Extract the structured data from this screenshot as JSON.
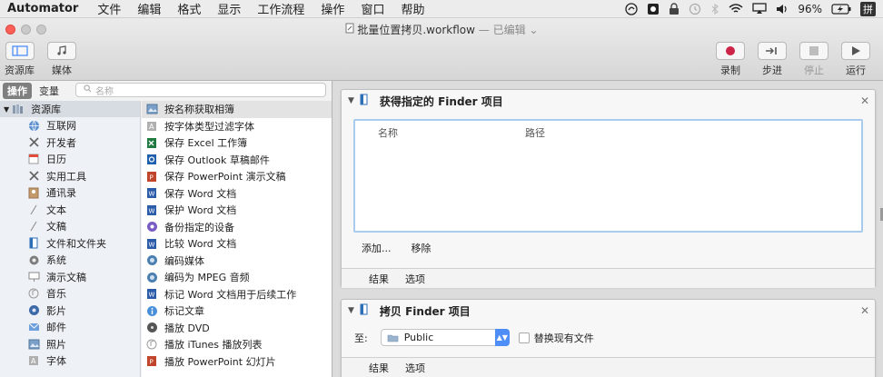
{
  "menubar": {
    "app": "Automator",
    "items": [
      "文件",
      "编辑",
      "格式",
      "显示",
      "工作流程",
      "操作",
      "窗口",
      "帮助"
    ],
    "battery": "96%",
    "input_method": "拼"
  },
  "window": {
    "title": "批量位置拷贝.workflow",
    "edited": "— 已编辑"
  },
  "toolbar": {
    "library": "资源库",
    "media": "媒体",
    "record": "录制",
    "step": "步进",
    "stop": "停止",
    "run": "运行"
  },
  "tabs": {
    "actions": "操作",
    "variables": "变量",
    "search_placeholder": "名称"
  },
  "library": {
    "header": "资源库",
    "items": [
      {
        "label": "互联网",
        "icon": "globe-icon"
      },
      {
        "label": "开发者",
        "icon": "tools-icon"
      },
      {
        "label": "日历",
        "icon": "calendar-icon"
      },
      {
        "label": "实用工具",
        "icon": "tools-icon"
      },
      {
        "label": "通讯录",
        "icon": "contacts-icon"
      },
      {
        "label": "文本",
        "icon": "pen-icon"
      },
      {
        "label": "文稿",
        "icon": "pen-icon"
      },
      {
        "label": "文件和文件夹",
        "icon": "finder-icon"
      },
      {
        "label": "系统",
        "icon": "gear-icon"
      },
      {
        "label": "演示文稿",
        "icon": "presentation-icon"
      },
      {
        "label": "音乐",
        "icon": "music-icon"
      },
      {
        "label": "影片",
        "icon": "film-icon"
      },
      {
        "label": "邮件",
        "icon": "mail-icon"
      },
      {
        "label": "照片",
        "icon": "photo-icon"
      },
      {
        "label": "字体",
        "icon": "font-icon"
      }
    ]
  },
  "actions": {
    "items": [
      {
        "label": "按名称获取相簿",
        "icon": "photo-icon",
        "color": "#6a8fb5"
      },
      {
        "label": "按字体类型过滤字体",
        "icon": "font-icon",
        "color": "#8a8a8a"
      },
      {
        "label": "保存 Excel 工作簿",
        "icon": "excel-icon",
        "color": "#1f7a3f"
      },
      {
        "label": "保存 Outlook 草稿邮件",
        "icon": "outlook-icon",
        "color": "#1f5fb0"
      },
      {
        "label": "保存 PowerPoint 演示文稿",
        "icon": "powerpoint-icon",
        "color": "#c0452a"
      },
      {
        "label": "保存 Word 文档",
        "icon": "word-icon",
        "color": "#2b5caa"
      },
      {
        "label": "保护 Word 文档",
        "icon": "word-icon",
        "color": "#2b5caa"
      },
      {
        "label": "备份指定的设备",
        "icon": "backup-icon",
        "color": "#7a5bc4"
      },
      {
        "label": "比较 Word 文档",
        "icon": "word-icon",
        "color": "#2b5caa"
      },
      {
        "label": "编码媒体",
        "icon": "media-icon",
        "color": "#4a7fb0"
      },
      {
        "label": "编码为 MPEG 音频",
        "icon": "media-icon",
        "color": "#4a7fb0"
      },
      {
        "label": "标记 Word 文档用于后续工作",
        "icon": "word-icon",
        "color": "#2b5caa"
      },
      {
        "label": "标记文章",
        "icon": "info-icon",
        "color": "#4a90d9"
      },
      {
        "label": "播放 DVD",
        "icon": "dvd-icon",
        "color": "#666666"
      },
      {
        "label": "播放 iTunes 播放列表",
        "icon": "music-icon",
        "color": "#888888"
      },
      {
        "label": "播放 PowerPoint 幻灯片",
        "icon": "powerpoint-icon",
        "color": "#c0452a"
      }
    ]
  },
  "workflow": {
    "card1": {
      "title": "获得指定的 Finder 项目",
      "col_name": "名称",
      "col_path": "路径",
      "add": "添加...",
      "remove": "移除",
      "results": "结果",
      "options": "选项"
    },
    "card2": {
      "title": "拷贝 Finder 项目",
      "to_label": "至:",
      "destination": "Public",
      "replace_label": "替换现有文件",
      "results": "结果",
      "options": "选项"
    }
  }
}
